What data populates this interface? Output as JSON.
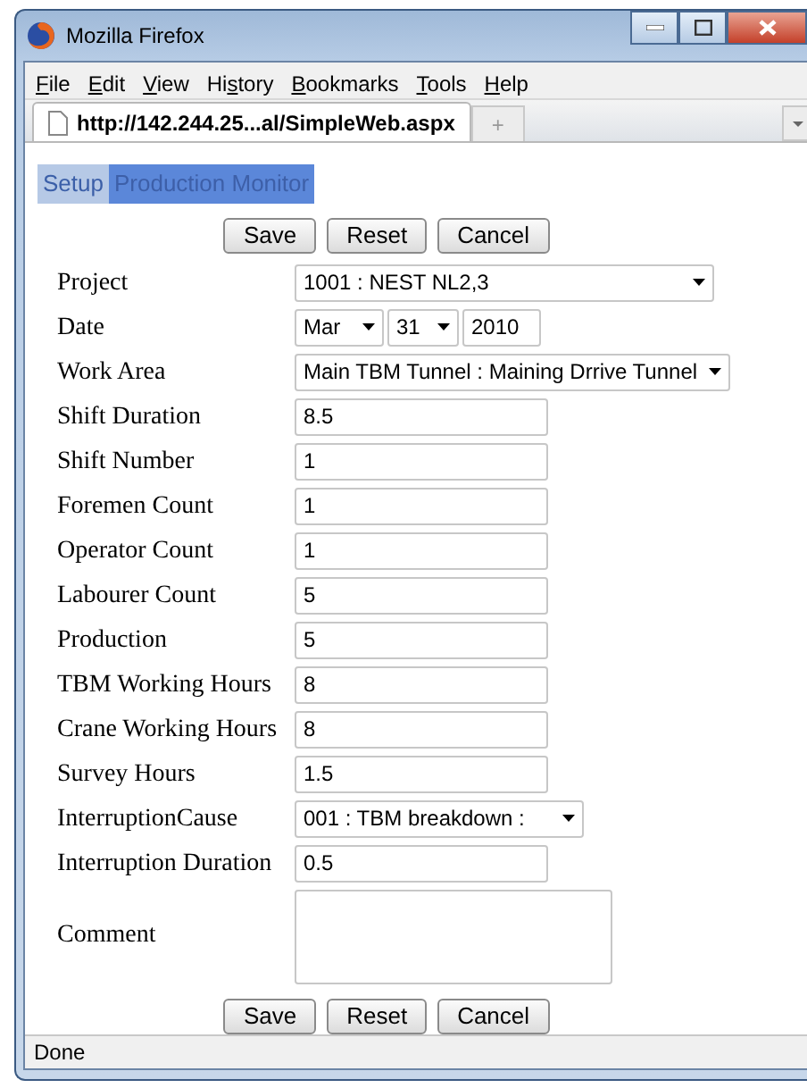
{
  "window": {
    "title": "Mozilla Firefox"
  },
  "menu": [
    {
      "access_key": "F",
      "after_key": "ile"
    },
    {
      "access_key": "E",
      "after_key": "dit"
    },
    {
      "access_key": "V",
      "after_key": "iew"
    },
    {
      "before_key": "Hi",
      "access_key": "s",
      "after_key": "tory"
    },
    {
      "access_key": "B",
      "after_key": "ookmarks"
    },
    {
      "access_key": "T",
      "after_key": "ools"
    },
    {
      "access_key": "H",
      "after_key": "elp"
    }
  ],
  "browser_tab": {
    "title": "http://142.244.25...al/SimpleWeb.aspx",
    "new_tab": "+"
  },
  "page_tabs": [
    {
      "label": "Setup",
      "selected": false
    },
    {
      "label": "Production Monitor",
      "selected": true
    }
  ],
  "buttons_top": [
    "Save",
    "Reset",
    "Cancel"
  ],
  "fields": [
    {
      "label": "Project",
      "kind": "select",
      "value": "1001 : NEST NL2,3"
    },
    {
      "label": "Date",
      "kind": "date",
      "month": "Mar",
      "day": "31",
      "year": "2010"
    },
    {
      "label": "Work Area",
      "kind": "select",
      "value": "Main TBM Tunnel : Maining Drrive Tunnel"
    },
    {
      "label": "Shift Duration",
      "kind": "text",
      "value": "8.5"
    },
    {
      "label": "Shift Number",
      "kind": "text",
      "value": "1"
    },
    {
      "label": "Foremen Count",
      "kind": "text",
      "value": "1"
    },
    {
      "label": "Operator Count",
      "kind": "text",
      "value": "1"
    },
    {
      "label": "Labourer Count",
      "kind": "text",
      "value": "5"
    },
    {
      "label": "Production",
      "kind": "text",
      "value": "5"
    },
    {
      "label": "TBM Working Hours",
      "kind": "text",
      "value": "8"
    },
    {
      "label": "Crane Working Hours",
      "kind": "text",
      "value": "8"
    },
    {
      "label": "Survey Hours",
      "kind": "text",
      "value": "1.5"
    },
    {
      "label": "InterruptionCause",
      "kind": "select",
      "value": "001 : TBM breakdown :"
    },
    {
      "label": "Interruption Duration",
      "kind": "text",
      "value": "0.5"
    },
    {
      "label": "Comment",
      "kind": "textarea"
    }
  ],
  "buttons_bottom": [
    "Save",
    "Reset",
    "Cancel"
  ],
  "status_bar": "Done"
}
